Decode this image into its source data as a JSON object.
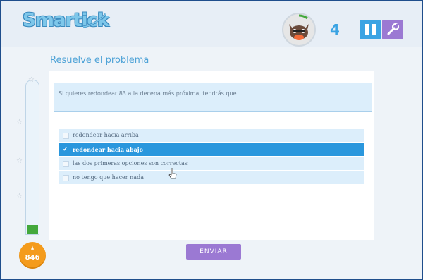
{
  "app": {
    "logo_text": "Smartick"
  },
  "header": {
    "score": "4"
  },
  "exercise": {
    "title": "Resuelve el problema",
    "problem": "Si quieres redondear 83 a la decena más próxima, tendrás que...",
    "options": [
      {
        "label": "redondear hacia arriba",
        "selected": false
      },
      {
        "label": "redondear hacia abajo",
        "selected": true
      },
      {
        "label": "las dos primeras opciones son correctas",
        "selected": false
      },
      {
        "label": "no tengo que hacer nada",
        "selected": false
      }
    ],
    "submit_label": "ENVIAR"
  },
  "sidebar": {
    "coins": "846",
    "progress_fraction": 0.06
  },
  "colors": {
    "accent_blue": "#2a97dd",
    "accent_purple": "#9b79d3",
    "coin_orange": "#f49b1c",
    "progress_green": "#43a83c"
  },
  "icons": [
    "pause-icon",
    "wrench-icon",
    "star-icon",
    "checkmark-icon",
    "cursor-icon"
  ]
}
